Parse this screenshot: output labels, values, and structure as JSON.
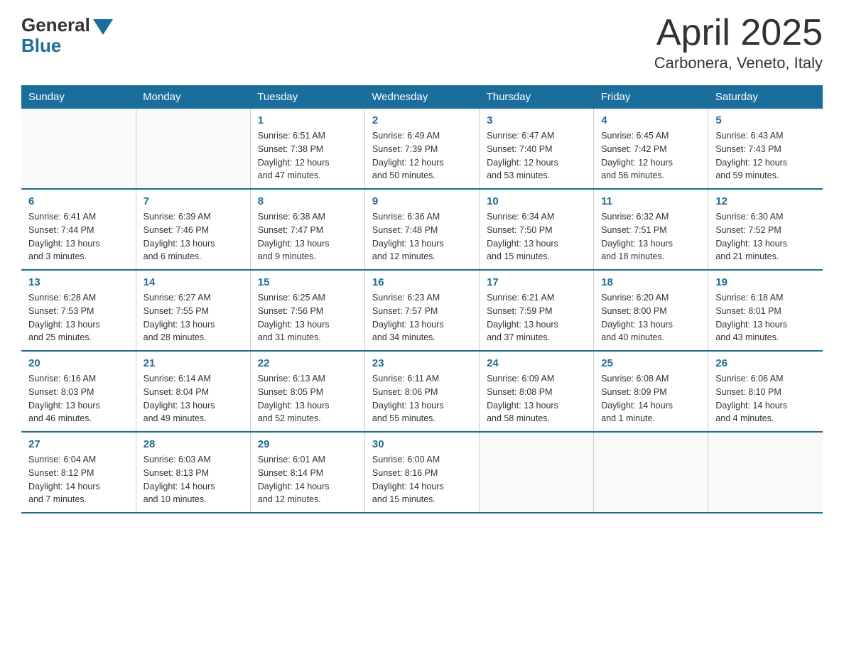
{
  "logo": {
    "general": "General",
    "blue": "Blue"
  },
  "title": "April 2025",
  "subtitle": "Carbonera, Veneto, Italy",
  "weekdays": [
    "Sunday",
    "Monday",
    "Tuesday",
    "Wednesday",
    "Thursday",
    "Friday",
    "Saturday"
  ],
  "weeks": [
    [
      {
        "day": "",
        "info": ""
      },
      {
        "day": "",
        "info": ""
      },
      {
        "day": "1",
        "info": "Sunrise: 6:51 AM\nSunset: 7:38 PM\nDaylight: 12 hours\nand 47 minutes."
      },
      {
        "day": "2",
        "info": "Sunrise: 6:49 AM\nSunset: 7:39 PM\nDaylight: 12 hours\nand 50 minutes."
      },
      {
        "day": "3",
        "info": "Sunrise: 6:47 AM\nSunset: 7:40 PM\nDaylight: 12 hours\nand 53 minutes."
      },
      {
        "day": "4",
        "info": "Sunrise: 6:45 AM\nSunset: 7:42 PM\nDaylight: 12 hours\nand 56 minutes."
      },
      {
        "day": "5",
        "info": "Sunrise: 6:43 AM\nSunset: 7:43 PM\nDaylight: 12 hours\nand 59 minutes."
      }
    ],
    [
      {
        "day": "6",
        "info": "Sunrise: 6:41 AM\nSunset: 7:44 PM\nDaylight: 13 hours\nand 3 minutes."
      },
      {
        "day": "7",
        "info": "Sunrise: 6:39 AM\nSunset: 7:46 PM\nDaylight: 13 hours\nand 6 minutes."
      },
      {
        "day": "8",
        "info": "Sunrise: 6:38 AM\nSunset: 7:47 PM\nDaylight: 13 hours\nand 9 minutes."
      },
      {
        "day": "9",
        "info": "Sunrise: 6:36 AM\nSunset: 7:48 PM\nDaylight: 13 hours\nand 12 minutes."
      },
      {
        "day": "10",
        "info": "Sunrise: 6:34 AM\nSunset: 7:50 PM\nDaylight: 13 hours\nand 15 minutes."
      },
      {
        "day": "11",
        "info": "Sunrise: 6:32 AM\nSunset: 7:51 PM\nDaylight: 13 hours\nand 18 minutes."
      },
      {
        "day": "12",
        "info": "Sunrise: 6:30 AM\nSunset: 7:52 PM\nDaylight: 13 hours\nand 21 minutes."
      }
    ],
    [
      {
        "day": "13",
        "info": "Sunrise: 6:28 AM\nSunset: 7:53 PM\nDaylight: 13 hours\nand 25 minutes."
      },
      {
        "day": "14",
        "info": "Sunrise: 6:27 AM\nSunset: 7:55 PM\nDaylight: 13 hours\nand 28 minutes."
      },
      {
        "day": "15",
        "info": "Sunrise: 6:25 AM\nSunset: 7:56 PM\nDaylight: 13 hours\nand 31 minutes."
      },
      {
        "day": "16",
        "info": "Sunrise: 6:23 AM\nSunset: 7:57 PM\nDaylight: 13 hours\nand 34 minutes."
      },
      {
        "day": "17",
        "info": "Sunrise: 6:21 AM\nSunset: 7:59 PM\nDaylight: 13 hours\nand 37 minutes."
      },
      {
        "day": "18",
        "info": "Sunrise: 6:20 AM\nSunset: 8:00 PM\nDaylight: 13 hours\nand 40 minutes."
      },
      {
        "day": "19",
        "info": "Sunrise: 6:18 AM\nSunset: 8:01 PM\nDaylight: 13 hours\nand 43 minutes."
      }
    ],
    [
      {
        "day": "20",
        "info": "Sunrise: 6:16 AM\nSunset: 8:03 PM\nDaylight: 13 hours\nand 46 minutes."
      },
      {
        "day": "21",
        "info": "Sunrise: 6:14 AM\nSunset: 8:04 PM\nDaylight: 13 hours\nand 49 minutes."
      },
      {
        "day": "22",
        "info": "Sunrise: 6:13 AM\nSunset: 8:05 PM\nDaylight: 13 hours\nand 52 minutes."
      },
      {
        "day": "23",
        "info": "Sunrise: 6:11 AM\nSunset: 8:06 PM\nDaylight: 13 hours\nand 55 minutes."
      },
      {
        "day": "24",
        "info": "Sunrise: 6:09 AM\nSunset: 8:08 PM\nDaylight: 13 hours\nand 58 minutes."
      },
      {
        "day": "25",
        "info": "Sunrise: 6:08 AM\nSunset: 8:09 PM\nDaylight: 14 hours\nand 1 minute."
      },
      {
        "day": "26",
        "info": "Sunrise: 6:06 AM\nSunset: 8:10 PM\nDaylight: 14 hours\nand 4 minutes."
      }
    ],
    [
      {
        "day": "27",
        "info": "Sunrise: 6:04 AM\nSunset: 8:12 PM\nDaylight: 14 hours\nand 7 minutes."
      },
      {
        "day": "28",
        "info": "Sunrise: 6:03 AM\nSunset: 8:13 PM\nDaylight: 14 hours\nand 10 minutes."
      },
      {
        "day": "29",
        "info": "Sunrise: 6:01 AM\nSunset: 8:14 PM\nDaylight: 14 hours\nand 12 minutes."
      },
      {
        "day": "30",
        "info": "Sunrise: 6:00 AM\nSunset: 8:16 PM\nDaylight: 14 hours\nand 15 minutes."
      },
      {
        "day": "",
        "info": ""
      },
      {
        "day": "",
        "info": ""
      },
      {
        "day": "",
        "info": ""
      }
    ]
  ]
}
